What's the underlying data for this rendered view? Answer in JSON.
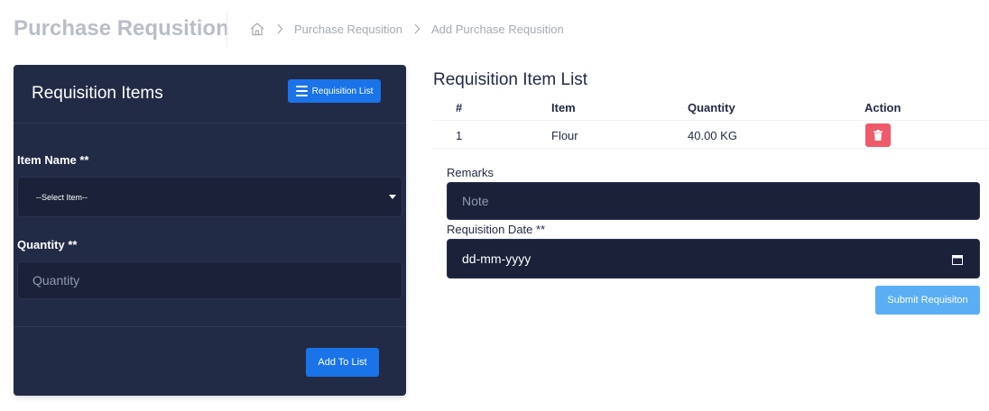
{
  "header": {
    "title": "Purchase Requsition",
    "breadcrumb": [
      "Purchase Requsition",
      "Add Purchase Requsition"
    ]
  },
  "left_card": {
    "title": "Requisition Items",
    "list_button": "Requisition List",
    "item_label": "Item Name **",
    "item_select_value": "--Select Item--",
    "quantity_label": "Quantity **",
    "quantity_placeholder": "Quantity",
    "add_button": "Add To List"
  },
  "item_list": {
    "title": "Requisition Item List",
    "columns": [
      "#",
      "Item",
      "Quantity",
      "Action"
    ],
    "rows": [
      {
        "no": "1",
        "item": "Flour",
        "quantity": "40.00 KG"
      }
    ]
  },
  "form": {
    "remarks_label": "Remarks",
    "remarks_placeholder": "Note",
    "date_label": "Requisition Date **",
    "date_value": "dd-mm-yyyy",
    "submit_button": "Submit Requisiton"
  },
  "colors": {
    "card_bg": "#222b45",
    "primary": "#1a73e8",
    "danger": "#ef5a6a",
    "submit": "#5aaef4"
  },
  "icons": [
    "home-icon",
    "chevron-right-icon",
    "list-icon",
    "dropdown-caret-icon",
    "trash-icon",
    "calendar-icon"
  ]
}
